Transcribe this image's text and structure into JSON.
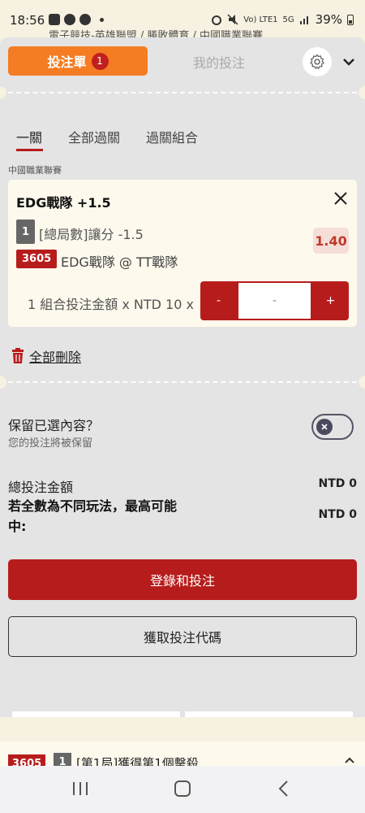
{
  "status_bar": {
    "time": "18:56",
    "network": "Vo) LTE1",
    "signal": "5G",
    "battery": "39%"
  },
  "behind_breadcrumb": "電子競技-英雄聯盟 / 勝敗體育 / 中國職業聯賽",
  "header": {
    "bet_slip_label": "投注單",
    "bet_slip_count": "1",
    "my_bets_label": "我的投注"
  },
  "subtabs": [
    {
      "label": "一關",
      "active": true
    },
    {
      "label": "全部過關",
      "active": false
    },
    {
      "label": "過關組合",
      "active": false
    }
  ],
  "league": "中國職業聯賽",
  "selection": {
    "title": "EDG戰隊 +1.5",
    "number": "1",
    "market": "[總局數]讓分 -1.5",
    "odds": "1.40",
    "match_id": "3605",
    "match": "EDG戰隊 @ TT戰隊",
    "stake_label": "1 組合投注金額 x NTD 10 x",
    "minus": "-",
    "plus": "+",
    "amount_placeholder": "-"
  },
  "delete_all_label": "全部刪除",
  "keep": {
    "title": "保留已選內容？",
    "subtitle": "您的投注將被保留",
    "toggle_on": false
  },
  "totals": {
    "total_label": "總投注金額",
    "total_value": "NTD 0",
    "max_win_label": "若全數為不同玩法，最高可能中:",
    "max_win_value": "NTD 0"
  },
  "buttons": {
    "login_bet": "登錄和投注",
    "get_code": "獲取投注代碼"
  },
  "behind_row": {
    "match_id": "3605",
    "number": "1",
    "text": "[第1局]獲得第1個擊殺"
  },
  "colors": {
    "accent_orange": "#f57c22",
    "primary_red": "#b71c1c",
    "sheet_bg": "#e4e4e4",
    "card_bg": "#fdf9ec"
  }
}
